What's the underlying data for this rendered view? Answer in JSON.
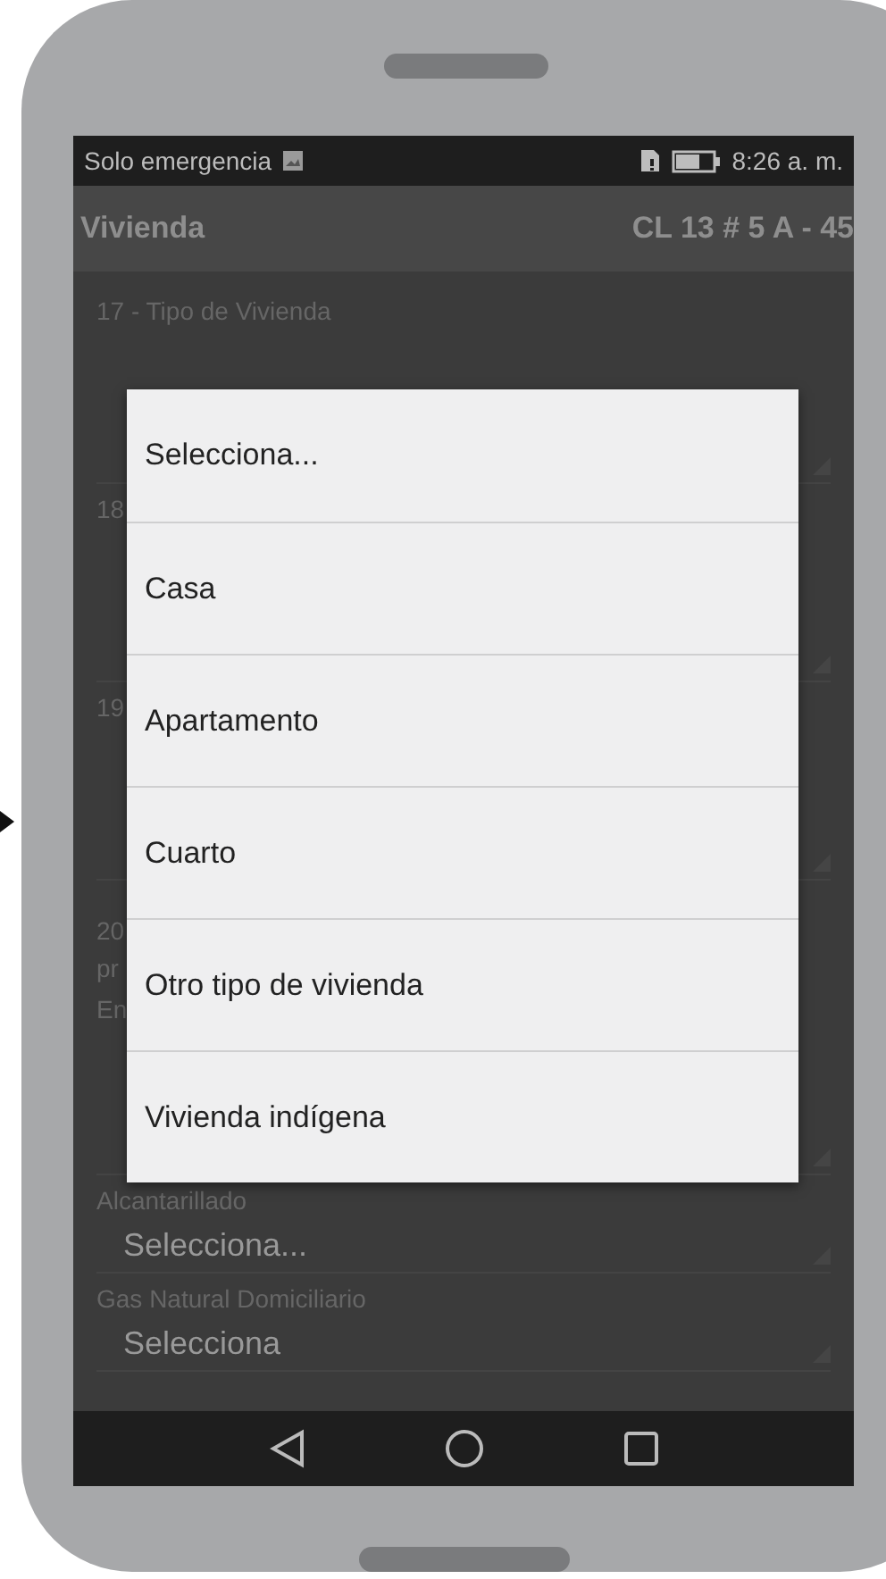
{
  "status_bar": {
    "carrier": "Solo emergencia",
    "time": "8:26 a. m."
  },
  "header": {
    "title": "Vivienda",
    "address": "CL 13 # 5 A - 45"
  },
  "form_fields": [
    {
      "kind": "wide_select",
      "label_lines": [
        "17 - Tipo de Vivienda"
      ]
    },
    {
      "kind": "wide_select",
      "label_lines": [
        "18"
      ]
    },
    {
      "kind": "wide_select",
      "label_lines": [
        "19"
      ]
    },
    {
      "kind": "heading",
      "label_lines": [
        "20",
        "pr"
      ]
    },
    {
      "kind": "select",
      "label_lines": [
        "En"
      ]
    },
    {
      "kind": "select",
      "label_lines": [
        "Alcantarillado"
      ],
      "value": "Selecciona..."
    },
    {
      "kind": "select",
      "label_lines": [
        "Gas Natural Domiciliario"
      ],
      "value": "Selecciona"
    }
  ],
  "dialog": {
    "options": [
      "Selecciona...",
      "Casa",
      "Apartamento",
      "Cuarto",
      "Otro tipo de vivienda",
      "Vivienda indígena"
    ]
  }
}
